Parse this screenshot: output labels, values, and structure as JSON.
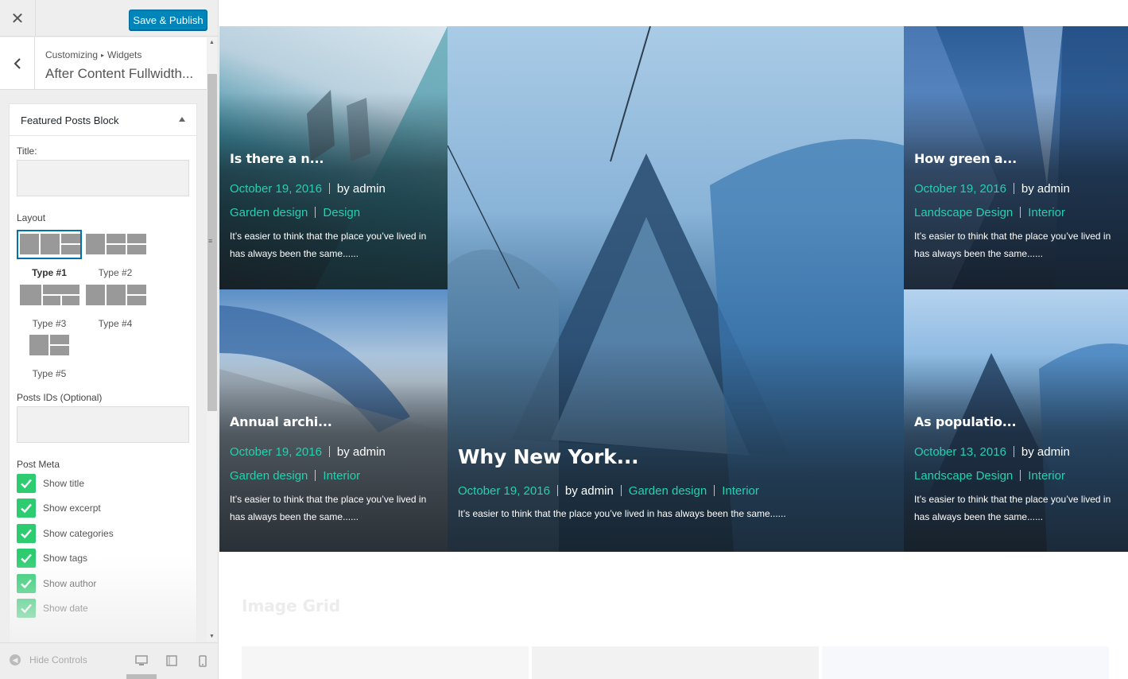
{
  "topbar": {
    "close_glyph": "✕",
    "save_label": "Save & Publish"
  },
  "panel": {
    "breadcrumb_root": "Customizing",
    "breadcrumb_sep": "▸",
    "breadcrumb_section": "Widgets",
    "title": "After Content Fullwidth..."
  },
  "widget": {
    "title": "Featured Posts Block",
    "title_field_label": "Title:",
    "title_field_value": "",
    "layout_label": "Layout",
    "layouts": [
      {
        "label": "Type #1",
        "selected": true
      },
      {
        "label": "Type #2",
        "selected": false
      },
      {
        "label": "Type #3",
        "selected": false
      },
      {
        "label": "Type #4",
        "selected": false
      },
      {
        "label": "Type #5",
        "selected": false
      }
    ],
    "posts_ids_label": "Posts IDs (Optional)",
    "posts_ids_value": "",
    "post_meta_label": "Post Meta",
    "post_meta": [
      {
        "label": "Show title",
        "checked": true
      },
      {
        "label": "Show excerpt",
        "checked": true
      },
      {
        "label": "Show categories",
        "checked": true
      },
      {
        "label": "Show tags",
        "checked": true
      },
      {
        "label": "Show author",
        "checked": true
      },
      {
        "label": "Show date",
        "checked": true
      }
    ]
  },
  "footer": {
    "hide_controls": "Hide Controls"
  },
  "preview": {
    "posts": [
      {
        "title": "Is there a n...",
        "date": "October 19, 2016",
        "author": "by admin",
        "categories": [
          "Garden design",
          "Design"
        ],
        "excerpt": "It’s easier to think that the place you’ve lived in has always been the same......"
      },
      {
        "title": "Why New York...",
        "date": "October 19, 2016",
        "author": "by admin",
        "categories": [
          "Garden design",
          "Interior"
        ],
        "excerpt": "It’s easier to think that the place you’ve lived in has always been the same......"
      },
      {
        "title": "How green a...",
        "date": "October 19, 2016",
        "author": "by admin",
        "categories": [
          "Landscape Design",
          "Interior"
        ],
        "excerpt": "It’s easier to think that the place you’ve lived in has always been the same......"
      },
      {
        "title": "Annual archi...",
        "date": "October 19, 2016",
        "author": "by admin",
        "categories": [
          "Garden design",
          "Interior"
        ],
        "excerpt": "It’s easier to think that the place you’ve lived in has always been the same......"
      },
      {
        "title": "As populatio...",
        "date": "October 13, 2016",
        "author": "by admin",
        "categories": [
          "Landscape Design",
          "Interior"
        ],
        "excerpt": "It’s easier to think that the place you’ve lived in has always been the same......"
      }
    ],
    "next_section_title": "Image Grid"
  },
  "colors": {
    "accent": "#25d0b0",
    "primary_button": "#0085ba",
    "checkbox": "#2ecc71"
  }
}
